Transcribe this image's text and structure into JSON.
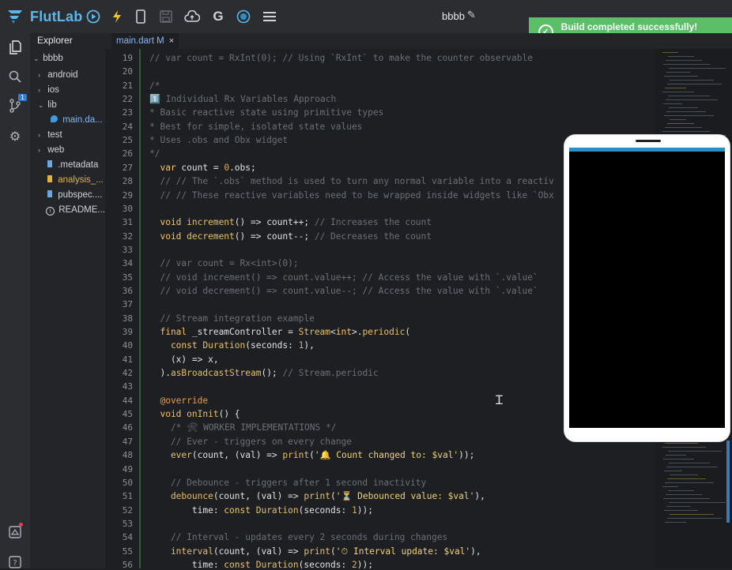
{
  "app": {
    "name": "FlutLab",
    "project_title": "bbbb"
  },
  "colors": {
    "accent": "#5bb6ea",
    "toast_bg": "#5bbf68",
    "phone_status": "#2e8ec4"
  },
  "toolbar": {
    "icons": [
      "play-circle-icon",
      "lightning-icon",
      "phone-device-icon",
      "save-icon",
      "cloud-upload-icon",
      "google-icon",
      "target-icon",
      "menu-icon"
    ]
  },
  "toast": {
    "message": "Build completed successfully! Uploading da"
  },
  "activity_bar": {
    "icons": [
      "files-icon",
      "search-icon",
      "source-control-icon",
      "settings-icon",
      "home-icon",
      "help-icon"
    ],
    "source_control_badge": "1"
  },
  "explorer": {
    "title": "Explorer",
    "items": [
      {
        "label": "bbbb",
        "type": "folder-open"
      },
      {
        "label": "android",
        "type": "folder"
      },
      {
        "label": "ios",
        "type": "folder"
      },
      {
        "label": "lib",
        "type": "folder-open"
      },
      {
        "label": "main.da...",
        "type": "file",
        "suffix": "M"
      },
      {
        "label": "test",
        "type": "folder"
      },
      {
        "label": "web",
        "type": "folder"
      },
      {
        "label": ".metadata",
        "type": "file"
      },
      {
        "label": "analysis_...",
        "type": "file"
      },
      {
        "label": "pubspec....",
        "type": "file"
      },
      {
        "label": "README....",
        "type": "file"
      }
    ]
  },
  "editor": {
    "tab": {
      "label": "main.dart M",
      "close": "×"
    },
    "lines": [
      {
        "n": "19",
        "parts": [
          [
            "cmt",
            "// var count = RxInt(0); // Using `RxInt` to make the counter observable"
          ]
        ]
      },
      {
        "n": "20",
        "parts": []
      },
      {
        "n": "21",
        "parts": [
          [
            "cmt",
            "/*"
          ]
        ]
      },
      {
        "n": "22",
        "parts": [
          [
            "cmt",
            "1️⃣ Individual Rx Variables Approach"
          ]
        ]
      },
      {
        "n": "23",
        "parts": [
          [
            "cmt",
            "* Basic reactive state using primitive types"
          ]
        ]
      },
      {
        "n": "24",
        "parts": [
          [
            "cmt",
            "* Best for simple, isolated state values"
          ]
        ]
      },
      {
        "n": "25",
        "parts": [
          [
            "cmt",
            "* Uses .obs and Obx widget"
          ]
        ]
      },
      {
        "n": "26",
        "parts": [
          [
            "cmt",
            "*/"
          ]
        ]
      },
      {
        "n": "27",
        "parts": [
          [
            "kw",
            "  var "
          ],
          [
            "var",
            "count = "
          ],
          [
            "num",
            "0"
          ],
          [
            "var",
            ".obs;"
          ]
        ]
      },
      {
        "n": "28",
        "parts": [
          [
            "cmt",
            "  // // The `.obs` method is used to turn any normal variable into a reactiv"
          ]
        ]
      },
      {
        "n": "29",
        "parts": [
          [
            "cmt",
            "  // // These reactive variables need to be wrapped inside widgets like `Obx"
          ]
        ]
      },
      {
        "n": "30",
        "parts": []
      },
      {
        "n": "31",
        "parts": [
          [
            "kw",
            "  void "
          ],
          [
            "fn",
            "increment"
          ],
          [
            "var",
            "() => count++; "
          ],
          [
            "cmt",
            "// Increases the count"
          ]
        ]
      },
      {
        "n": "32",
        "parts": [
          [
            "kw",
            "  void "
          ],
          [
            "fn",
            "decrement"
          ],
          [
            "var",
            "() => count--; "
          ],
          [
            "cmt",
            "// Decreases the count"
          ]
        ]
      },
      {
        "n": "33",
        "parts": []
      },
      {
        "n": "34",
        "parts": [
          [
            "cmt",
            "  // var count = Rx<int>(0);"
          ]
        ]
      },
      {
        "n": "35",
        "parts": [
          [
            "cmt",
            "  // void increment() => count.value++; // Access the value with `.value`"
          ]
        ]
      },
      {
        "n": "36",
        "parts": [
          [
            "cmt",
            "  // void decrement() => count.value--; // Access the value with `.value`"
          ]
        ]
      },
      {
        "n": "37",
        "parts": []
      },
      {
        "n": "38",
        "parts": [
          [
            "cmt",
            "  // Stream integration example"
          ]
        ]
      },
      {
        "n": "39",
        "parts": [
          [
            "kw",
            "  final "
          ],
          [
            "var",
            "_streamController = "
          ],
          [
            "fn",
            "Stream"
          ],
          [
            "var",
            "<"
          ],
          [
            "kw",
            "int"
          ],
          [
            "var",
            ">."
          ],
          [
            "fn",
            "periodic"
          ],
          [
            "var",
            "("
          ]
        ]
      },
      {
        "n": "40",
        "parts": [
          [
            "kw",
            "    const "
          ],
          [
            "fn",
            "Duration"
          ],
          [
            "var",
            "(seconds: "
          ],
          [
            "num",
            "1"
          ],
          [
            "var",
            "),"
          ]
        ]
      },
      {
        "n": "41",
        "parts": [
          [
            "var",
            "    (x) => x,"
          ]
        ]
      },
      {
        "n": "42",
        "parts": [
          [
            "var",
            "  )."
          ],
          [
            "fn",
            "asBroadcastStream"
          ],
          [
            "var",
            "(); "
          ],
          [
            "cmt",
            "// Stream.periodic"
          ]
        ]
      },
      {
        "n": "43",
        "parts": []
      },
      {
        "n": "44",
        "parts": [
          [
            "anno",
            "  @override"
          ]
        ]
      },
      {
        "n": "45",
        "parts": [
          [
            "kw",
            "  void "
          ],
          [
            "fn",
            "onInit"
          ],
          [
            "var",
            "() {"
          ]
        ]
      },
      {
        "n": "46",
        "parts": [
          [
            "cmt",
            "    /* 🛠 WORKER IMPLEMENTATIONS */"
          ]
        ]
      },
      {
        "n": "47",
        "parts": [
          [
            "cmt",
            "    // Ever - triggers on every change"
          ]
        ]
      },
      {
        "n": "48",
        "parts": [
          [
            "fn",
            "    ever"
          ],
          [
            "var",
            "(count, (val) => "
          ],
          [
            "fn",
            "print"
          ],
          [
            "var",
            "("
          ],
          [
            "str",
            "'🔔 Count changed to: $val'"
          ],
          [
            "var",
            "));"
          ]
        ]
      },
      {
        "n": "49",
        "parts": []
      },
      {
        "n": "50",
        "parts": [
          [
            "cmt",
            "    // Debounce - triggers after 1 second inactivity"
          ]
        ]
      },
      {
        "n": "51",
        "parts": [
          [
            "fn",
            "    debounce"
          ],
          [
            "var",
            "(count, (val) => "
          ],
          [
            "fn",
            "print"
          ],
          [
            "var",
            "("
          ],
          [
            "str",
            "'⏳ Debounced value: $val'"
          ],
          [
            "var",
            "),"
          ]
        ]
      },
      {
        "n": "52",
        "parts": [
          [
            "var",
            "        time: "
          ],
          [
            "kw",
            "const "
          ],
          [
            "fn",
            "Duration"
          ],
          [
            "var",
            "(seconds: "
          ],
          [
            "num",
            "1"
          ],
          [
            "var",
            "));"
          ]
        ]
      },
      {
        "n": "53",
        "parts": []
      },
      {
        "n": "54",
        "parts": [
          [
            "cmt",
            "    // Interval - updates every 2 seconds during changes"
          ]
        ]
      },
      {
        "n": "55",
        "parts": [
          [
            "fn",
            "    interval"
          ],
          [
            "var",
            "(count, (val) => "
          ],
          [
            "fn",
            "print"
          ],
          [
            "var",
            "("
          ],
          [
            "str",
            "'⏱ Interval update: $val'"
          ],
          [
            "var",
            "),"
          ]
        ]
      },
      {
        "n": "56",
        "parts": [
          [
            "var",
            "        time: "
          ],
          [
            "kw",
            "const "
          ],
          [
            "fn",
            "Duration"
          ],
          [
            "var",
            "(seconds: "
          ],
          [
            "num",
            "2"
          ],
          [
            "var",
            "));"
          ]
        ]
      }
    ]
  }
}
